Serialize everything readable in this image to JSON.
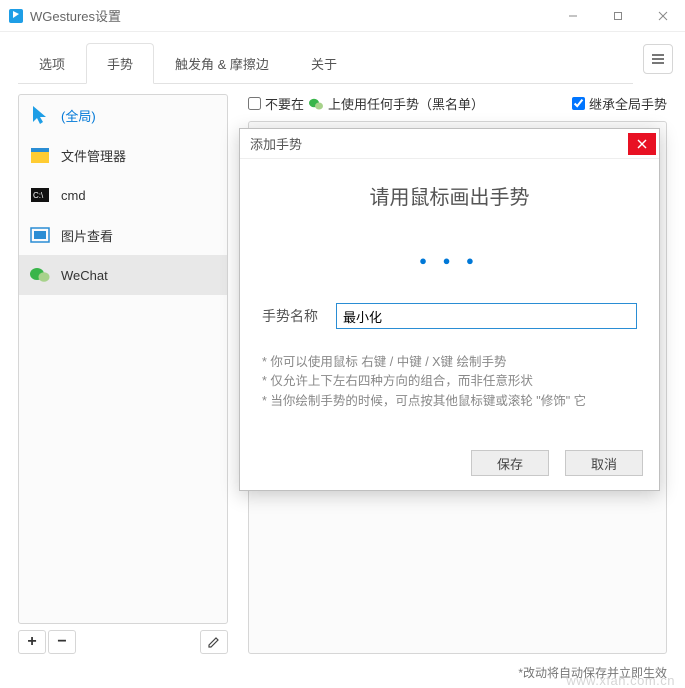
{
  "window": {
    "title": "WGestures设置"
  },
  "tabs": [
    "选项",
    "手势",
    "触发角 & 摩擦边",
    "关于"
  ],
  "sidebar": {
    "items": [
      {
        "label": "(全局)"
      },
      {
        "label": "文件管理器"
      },
      {
        "label": "cmd"
      },
      {
        "label": "图片查看"
      },
      {
        "label": "WeChat"
      }
    ]
  },
  "options": {
    "blacklist_pre": "不要在",
    "blacklist_post": "上使用任何手势（黑名单）",
    "inherit": "继承全局手势"
  },
  "footer": {
    "note": "*改动将自动保存并立即生效",
    "watermark": "www.xfan.com.cn"
  },
  "dialog": {
    "title": "添加手势",
    "heading": "请用鼠标画出手势",
    "preview": "● ● ●",
    "name_label": "手势名称",
    "name_value": "最小化",
    "hint1": "* 你可以使用鼠标 右键 / 中键 / X键 绘制手势",
    "hint2": "* 仅允许上下左右四种方向的组合，而非任意形状",
    "hint3": "* 当你绘制手势的时候，可点按其他鼠标键或滚轮 \"修饰\" 它",
    "save": "保存",
    "cancel": "取消"
  }
}
